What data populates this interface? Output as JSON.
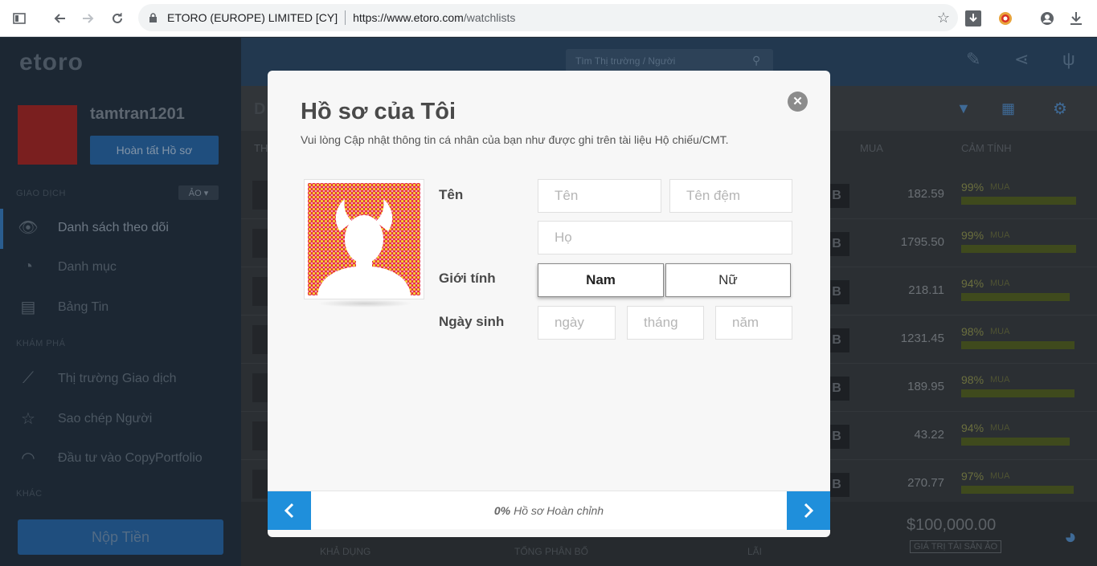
{
  "browser": {
    "org": "ETORO (EUROPE) LIMITED [CY]",
    "url_host": "https://www.etoro.com",
    "url_path": "/watchlists"
  },
  "app": {
    "brand": "etoro",
    "username": "tamtran1201",
    "complete_profile": "Hoàn tất Hồ sơ",
    "sections": {
      "trade": "GIAO DỊCH",
      "explore": "KHÁM PHÁ",
      "other": "KHÁC"
    },
    "virtual_badge": "ẢO ▾",
    "sidebar": [
      {
        "label": "Danh sách theo dõi",
        "icon": "eye-icon"
      },
      {
        "label": "Danh mục",
        "icon": "pie-icon"
      },
      {
        "label": "Bảng Tin",
        "icon": "news-icon"
      },
      {
        "label": "Thị trường Giao dịch",
        "icon": "trend-icon"
      },
      {
        "label": "Sao chép Người",
        "icon": "star-icon"
      },
      {
        "label": "Đầu tư vào CopyPortfolio",
        "icon": "gauge-icon"
      }
    ],
    "deposit": "Nộp Tiền",
    "search_placeholder": "Tìm Thị trường / Người",
    "columns": {
      "buy": "MUA",
      "sentiment": "CẢM TÍNH"
    },
    "rows": [
      {
        "price": "182.59",
        "pct": "99%",
        "buy": "MUA",
        "sentiment": 0.99
      },
      {
        "price": "1795.50",
        "pct": "99%",
        "buy": "MUA",
        "sentiment": 0.99
      },
      {
        "price": "218.11",
        "pct": "94%",
        "buy": "MUA",
        "sentiment": 0.94
      },
      {
        "price": "1231.45",
        "pct": "98%",
        "buy": "MUA",
        "sentiment": 0.98
      },
      {
        "price": "189.95",
        "pct": "98%",
        "buy": "MUA",
        "sentiment": 0.98
      },
      {
        "price": "43.22",
        "pct": "94%",
        "buy": "MUA",
        "sentiment": 0.94
      },
      {
        "price": "270.77",
        "pct": "97%",
        "buy": "MUA",
        "sentiment": 0.97
      }
    ],
    "bottom": {
      "available": "KHẢ DỤNG",
      "allocated": "TỔNG PHÂN BỔ",
      "profit": "LÃI",
      "total": "$100,000.00",
      "total_label": "GIÁ TRỊ TÀI SẢN ẢO"
    }
  },
  "modal": {
    "title": "Hồ sơ của Tôi",
    "subtitle": "Vui lòng Cập nhật thông tin cá nhân của bạn như được ghi trên tài liệu Hộ chiếu/CMT.",
    "labels": {
      "name": "Tên",
      "gender": "Giới tính",
      "dob": "Ngày sinh"
    },
    "placeholders": {
      "first_name": "Tên",
      "middle_name": "Tên đệm",
      "last_name": "Họ",
      "day": "ngày",
      "month": "tháng",
      "year": "năm"
    },
    "gender": {
      "male": "Nam",
      "female": "Nữ",
      "selected": "Nam"
    },
    "progress_pct": "0%",
    "progress_label": "Hồ sơ Hoàn chỉnh",
    "close": "✕"
  }
}
